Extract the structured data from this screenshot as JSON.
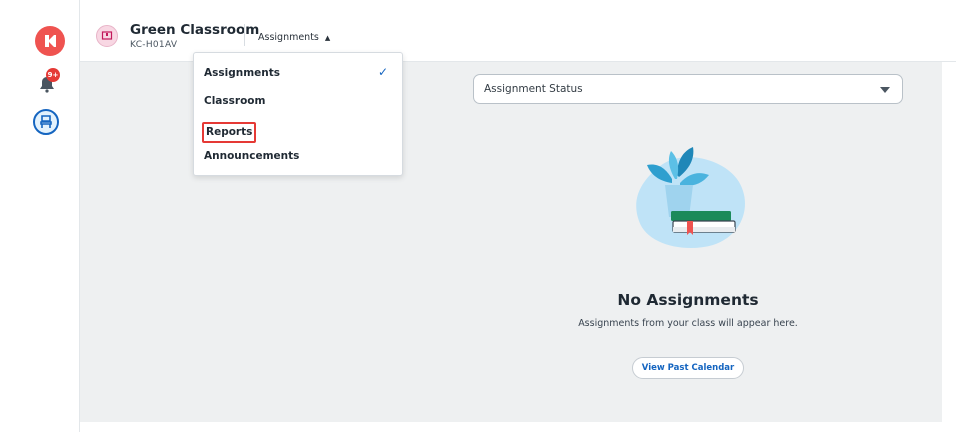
{
  "header": {
    "class_name": "Green Classroom",
    "class_code": "KC-H01AV",
    "nav_label": "Assignments",
    "nav_caret": "▲"
  },
  "rail": {
    "notification_badge": "9+"
  },
  "menu": {
    "items": [
      {
        "label": "Assignments",
        "selected": true
      },
      {
        "label": "Classroom"
      },
      {
        "label": "Reports",
        "highlighted": true
      },
      {
        "label": "Announcements"
      }
    ],
    "check_glyph": "✓"
  },
  "filter": {
    "label": "Assignment Status"
  },
  "empty_state": {
    "title": "No Assignments",
    "subtitle": "Assignments from your class will appear here.",
    "button_label": "View Past Calendar"
  },
  "colors": {
    "brand_red": "#ef5350",
    "accent_blue": "#1565c0",
    "content_bg": "#eef0f1",
    "highlight_border": "#e53935"
  }
}
